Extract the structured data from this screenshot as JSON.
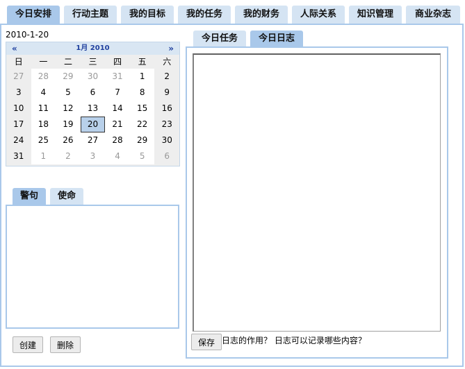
{
  "top_tabs": [
    {
      "label": "今日安排",
      "active": true
    },
    {
      "label": "行动主题",
      "active": false
    },
    {
      "label": "我的目标",
      "active": false
    },
    {
      "label": "我的任务",
      "active": false
    },
    {
      "label": "我的财务",
      "active": false
    },
    {
      "label": "人际关系",
      "active": false
    },
    {
      "label": "知识管理",
      "active": false
    },
    {
      "label": "商业杂志",
      "active": false
    }
  ],
  "date_label": "2010-1-20",
  "calendar": {
    "prev": "«",
    "next": "»",
    "month_title": "1月 2010",
    "weekdays": [
      "日",
      "一",
      "二",
      "三",
      "四",
      "五",
      "六"
    ],
    "days": [
      {
        "d": "27",
        "other": true
      },
      {
        "d": "28",
        "other": true
      },
      {
        "d": "29",
        "other": true
      },
      {
        "d": "30",
        "other": true
      },
      {
        "d": "31",
        "other": true
      },
      {
        "d": "1"
      },
      {
        "d": "2"
      },
      {
        "d": "3"
      },
      {
        "d": "4"
      },
      {
        "d": "5"
      },
      {
        "d": "6"
      },
      {
        "d": "7"
      },
      {
        "d": "8"
      },
      {
        "d": "9"
      },
      {
        "d": "10"
      },
      {
        "d": "11"
      },
      {
        "d": "12"
      },
      {
        "d": "13"
      },
      {
        "d": "14"
      },
      {
        "d": "15"
      },
      {
        "d": "16"
      },
      {
        "d": "17"
      },
      {
        "d": "18"
      },
      {
        "d": "19"
      },
      {
        "d": "20",
        "today": true
      },
      {
        "d": "21"
      },
      {
        "d": "22"
      },
      {
        "d": "23"
      },
      {
        "d": "24"
      },
      {
        "d": "25"
      },
      {
        "d": "26"
      },
      {
        "d": "27"
      },
      {
        "d": "28"
      },
      {
        "d": "29"
      },
      {
        "d": "30"
      },
      {
        "d": "31"
      },
      {
        "d": "1",
        "other": true
      },
      {
        "d": "2",
        "other": true
      },
      {
        "d": "3",
        "other": true
      },
      {
        "d": "4",
        "other": true
      },
      {
        "d": "5",
        "other": true
      },
      {
        "d": "6",
        "other": true
      }
    ]
  },
  "left_tabs": {
    "quote": "警句",
    "mission": "使命"
  },
  "buttons": {
    "create": "创建",
    "delete": "删除",
    "save": "保存"
  },
  "right_tabs": {
    "tasks": "今日任务",
    "log": "今日日志"
  },
  "log_hint": "日志的作用？ 日志可以记录哪些内容？",
  "colors": {
    "tab_active": "#a9c8ea",
    "tab_inactive": "#d5e4f3",
    "panel_border": "#a9c8ea",
    "cal_title": "#1f3f9e"
  }
}
